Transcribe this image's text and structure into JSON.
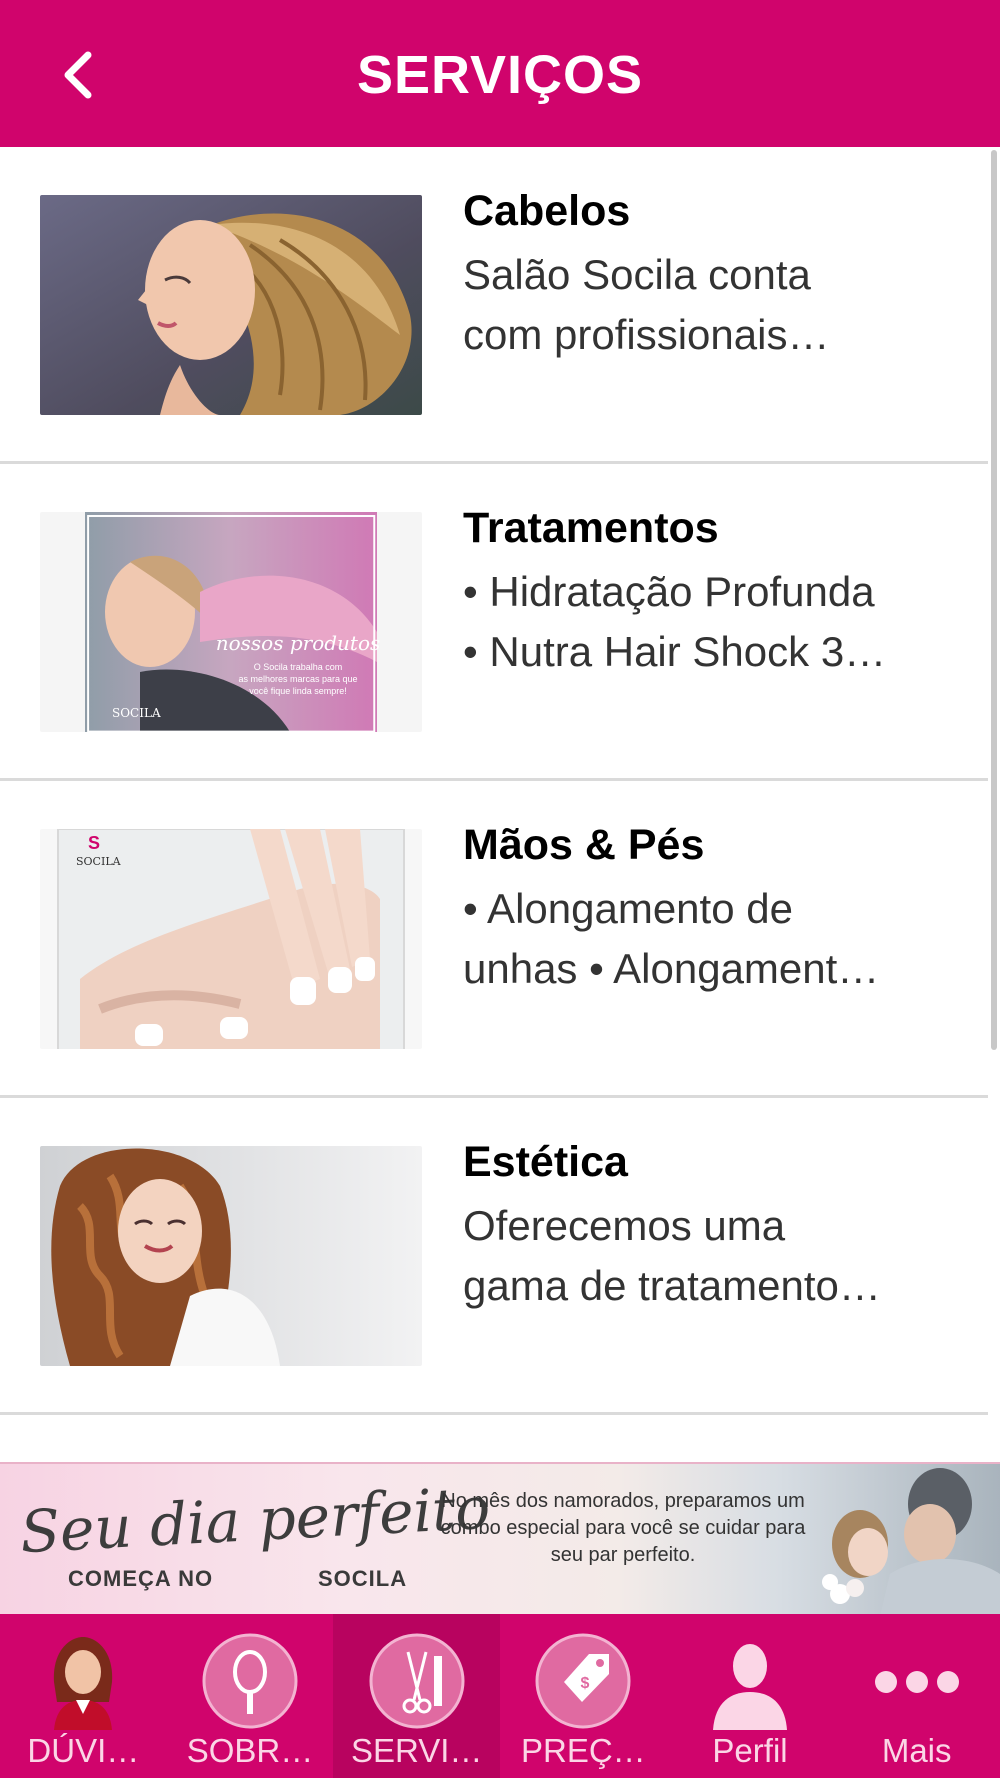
{
  "header": {
    "title": "SERVIÇOS",
    "back_icon": "chevron-left-icon"
  },
  "services": [
    {
      "title": "Cabelos",
      "desc": "Salão Socila conta\ncom profissionais…"
    },
    {
      "title": "Tratamentos",
      "desc": "• Hidratação Profunda\n• Nutra Hair Shock 3…",
      "thumb_text": "nossos produtos",
      "thumb_small": "O Socila trabalha com as melhores marcas para que você fique linda sempre!",
      "thumb_logo": "SOCILA"
    },
    {
      "title": "Mãos & Pés",
      "desc": "• Alongamento de\nunhas • Alongament…",
      "thumb_logo": "SOCILA"
    },
    {
      "title": "Estética",
      "desc": "Oferecemos uma\ngama de tratamento…"
    }
  ],
  "banner": {
    "script": "Seu dia perfeito",
    "sub_left": "COMEÇA NO",
    "sub_right": "SOCILA",
    "text": "No mês dos namorados, preparamos um combo especial para você se cuidar para seu par perfeito."
  },
  "tabs": [
    {
      "label": "DÚVI…",
      "icon": "woman-avatar-icon"
    },
    {
      "label": "SOBR…",
      "icon": "mirror-icon"
    },
    {
      "label": "SERVI…",
      "icon": "scissors-comb-icon",
      "active": true
    },
    {
      "label": "PREÇ…",
      "icon": "price-tag-icon"
    },
    {
      "label": "Perfil",
      "icon": "person-icon"
    },
    {
      "label": "Mais",
      "icon": "more-dots-icon"
    }
  ],
  "colors": {
    "primary": "#d0046c",
    "active_tab": "#b8035f",
    "divider": "#dadada"
  }
}
